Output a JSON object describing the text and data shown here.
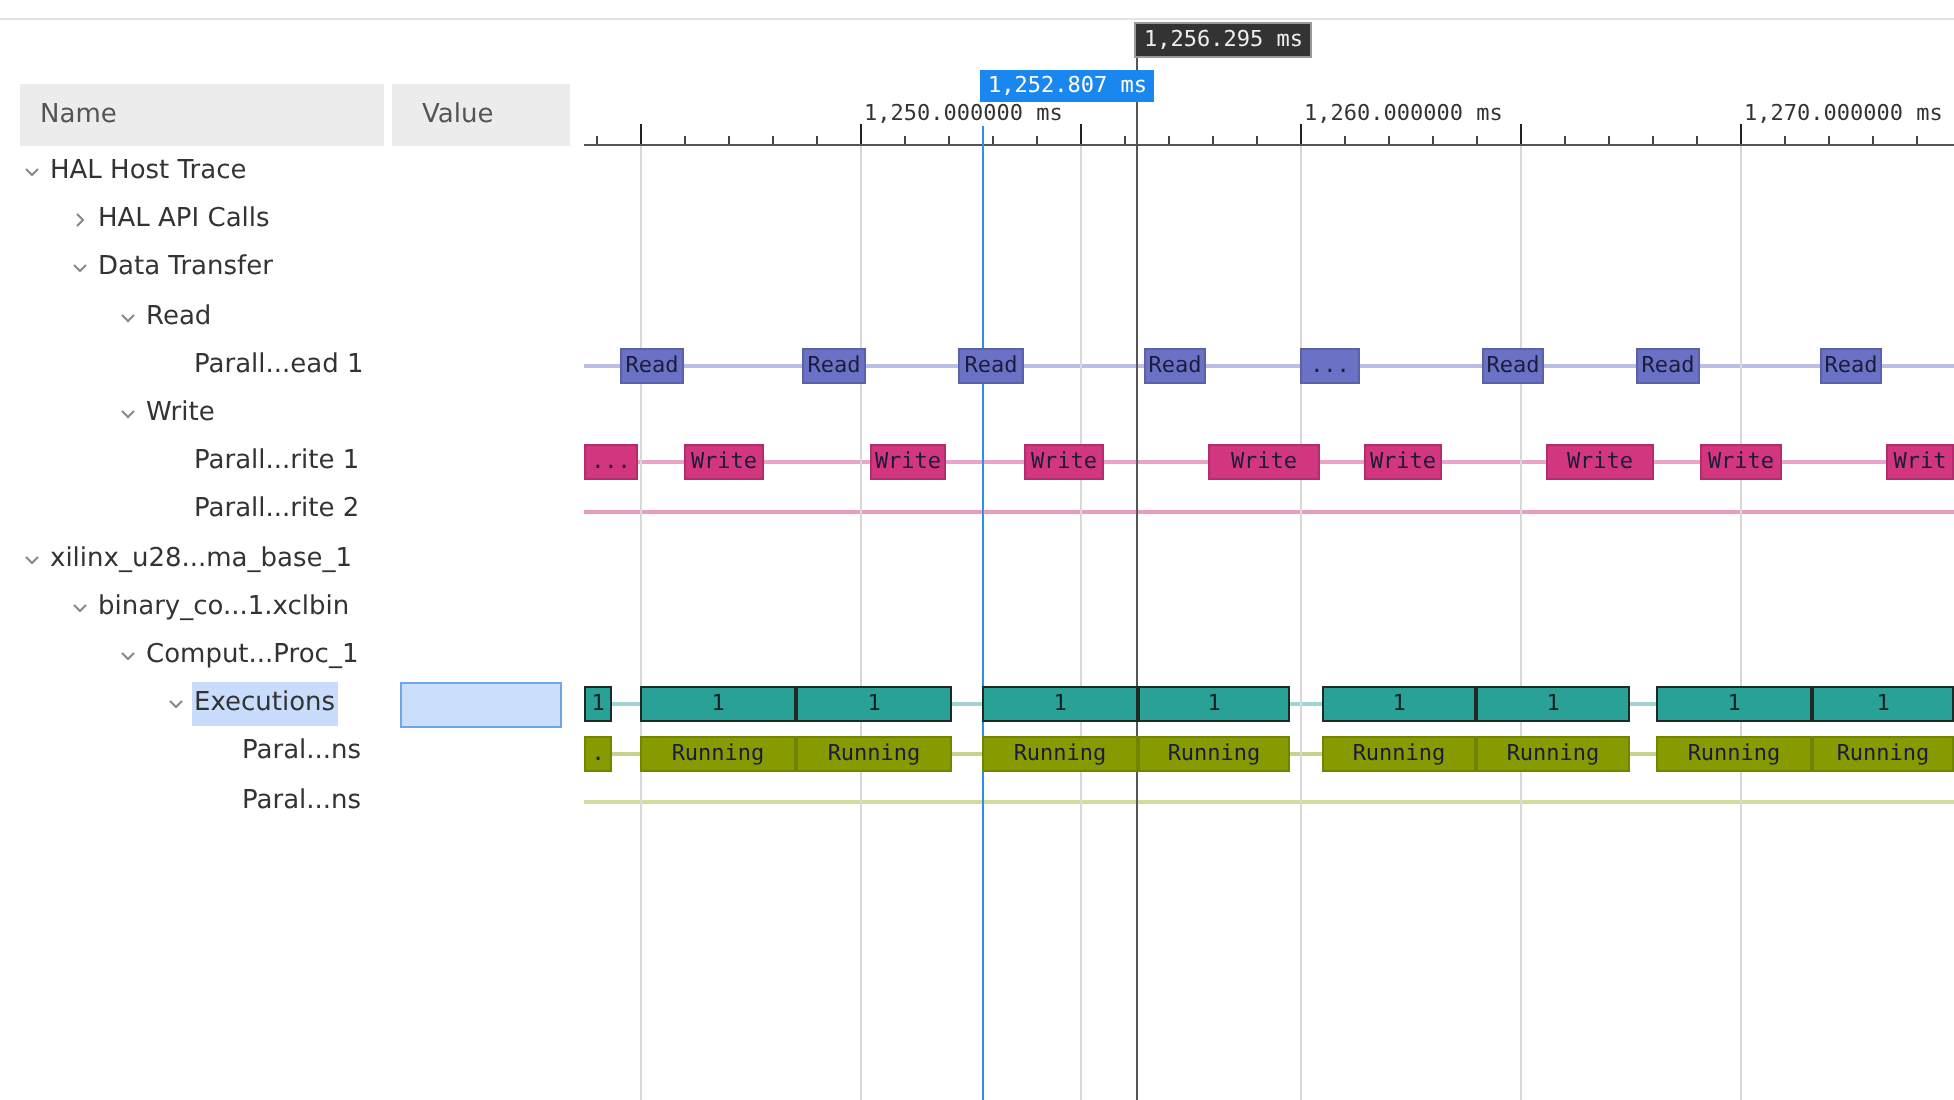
{
  "columns": [
    {
      "label": "Name"
    },
    {
      "label": "Value"
    }
  ],
  "ruler": {
    "labels": [
      "1,250.000000 ms",
      "1,260.000000 ms",
      "1,270.000000 ms"
    ]
  },
  "cursors": [
    {
      "kind": "marker",
      "label": "1,256.295 ms"
    },
    {
      "kind": "selection",
      "label": "1,252.807 ms"
    }
  ],
  "tree": [
    {
      "name": "HAL Host Trace",
      "expanded": true,
      "selected": false,
      "children": [
        {
          "name": "HAL API Calls",
          "expanded": false,
          "selected": false
        },
        {
          "name": "Data Transfer",
          "expanded": true,
          "selected": false,
          "children": [
            {
              "name": "Read",
              "expanded": true,
              "selected": false,
              "children": [
                {
                  "name": "Parall...ead 1",
                  "selected": false,
                  "trace": {
                    "kind": "events",
                    "color": "#6b72c6",
                    "segments": [
                      "Read",
                      "Read",
                      "Read",
                      "Read",
                      "...",
                      "Read",
                      "Read",
                      "Read"
                    ]
                  }
                }
              ]
            },
            {
              "name": "Write",
              "expanded": true,
              "selected": false,
              "children": [
                {
                  "name": "Parall...rite 1",
                  "selected": false,
                  "trace": {
                    "kind": "events",
                    "color": "#d2367e",
                    "segments": [
                      "...",
                      "Write",
                      "Write",
                      "Write",
                      "Write",
                      "Write",
                      "Write",
                      "Write",
                      "Writ"
                    ]
                  }
                },
                {
                  "name": "Parall...rite 2",
                  "selected": false,
                  "trace": {
                    "kind": "line",
                    "color": "#ec9cc2"
                  }
                }
              ]
            }
          ]
        }
      ]
    },
    {
      "name": "xilinx_u28...ma_base_1",
      "expanded": true,
      "selected": false,
      "children": [
        {
          "name": "binary_co...1.xclbin",
          "expanded": true,
          "selected": false,
          "children": [
            {
              "name": "Comput...Proc_1",
              "expanded": true,
              "selected": false,
              "children": [
                {
                  "name": "Executions",
                  "expanded": true,
                  "selected": true,
                  "trace": {
                    "kind": "states",
                    "color": "#2aa197",
                    "segments": [
                      "1",
                      "1",
                      "1",
                      "1",
                      "1",
                      "1",
                      "1",
                      "1",
                      "1"
                    ]
                  },
                  "children": [
                    {
                      "name": "Paral...ns",
                      "selected": false,
                      "trace": {
                        "kind": "events",
                        "color": "#879a00",
                        "segments": [
                          ".",
                          "Running",
                          "Running",
                          "Running",
                          "Running",
                          "Running",
                          "Running",
                          "Running",
                          "Running"
                        ]
                      }
                    },
                    {
                      "name": "Paral...ns",
                      "selected": false,
                      "trace": {
                        "kind": "line",
                        "color": "#d3dc9c"
                      }
                    }
                  ]
                }
              ]
            }
          ]
        }
      ]
    }
  ]
}
